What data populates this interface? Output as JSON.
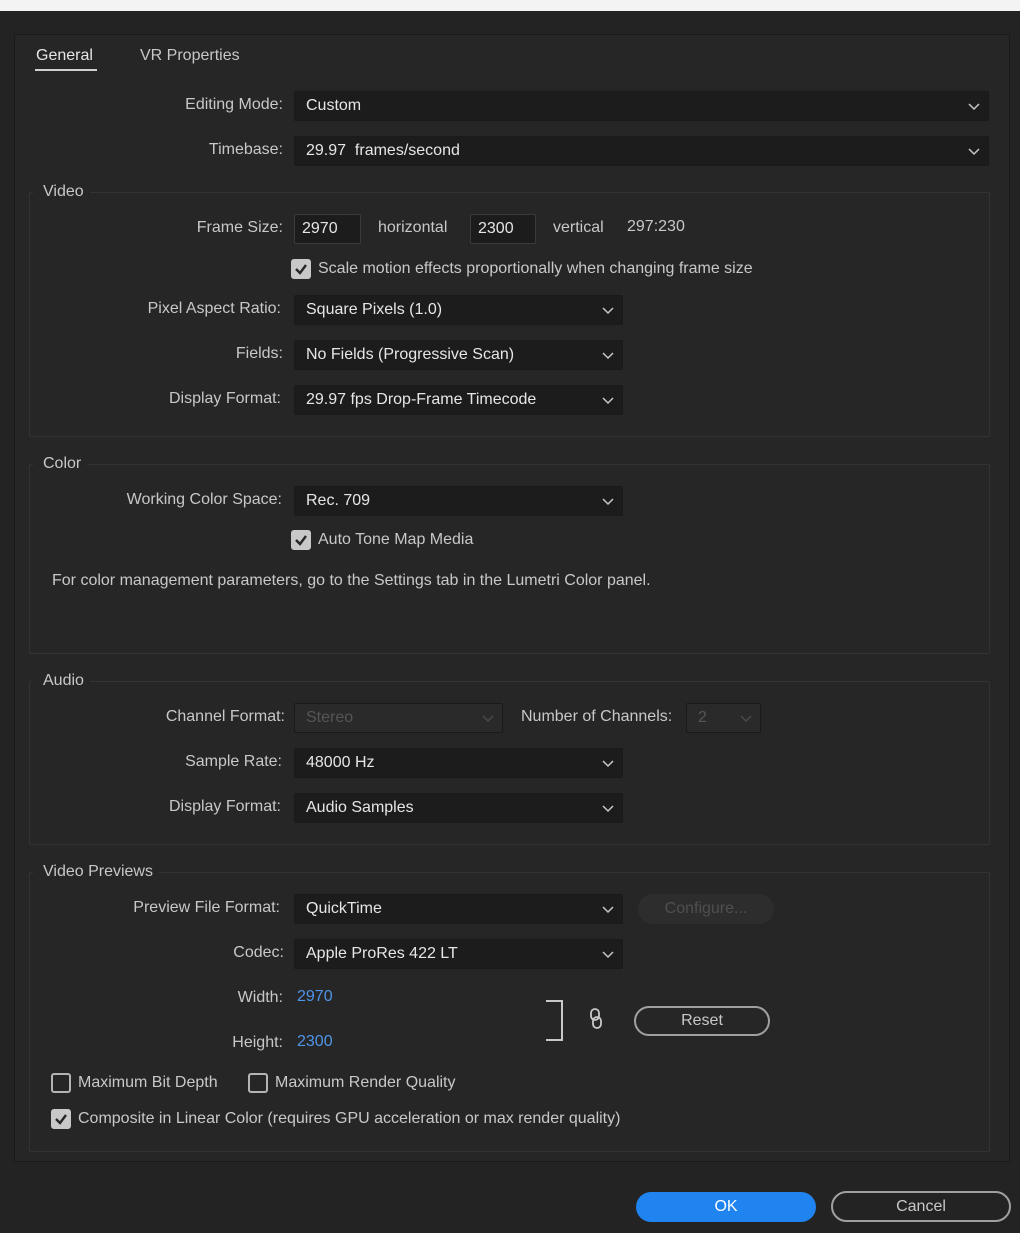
{
  "tabs": {
    "general": "General",
    "vr": "VR Properties"
  },
  "editing_mode": {
    "label": "Editing Mode:",
    "value": "Custom"
  },
  "timebase": {
    "label": "Timebase:",
    "value": "29.97  frames/second"
  },
  "video": {
    "title": "Video",
    "frame_size_label": "Frame Size:",
    "width": "2970",
    "horizontal_label": "horizontal",
    "height": "2300",
    "vertical_label": "vertical",
    "ratio": "297:230",
    "scale_motion_label": "Scale motion effects proportionally when changing frame size",
    "pixel_aspect_label": "Pixel Aspect Ratio:",
    "pixel_aspect_value": "Square Pixels (1.0)",
    "fields_label": "Fields:",
    "fields_value": "No Fields (Progressive Scan)",
    "display_format_label": "Display Format:",
    "display_format_value": "29.97 fps Drop-Frame Timecode"
  },
  "color": {
    "title": "Color",
    "working_space_label": "Working Color Space:",
    "working_space_value": "Rec. 709",
    "auto_tone_label": "Auto Tone Map Media",
    "note": "For color management parameters, go to the Settings tab in the Lumetri Color panel."
  },
  "audio": {
    "title": "Audio",
    "channel_format_label": "Channel Format:",
    "channel_format_value": "Stereo",
    "num_channels_label": "Number of Channels:",
    "num_channels_value": "2",
    "sample_rate_label": "Sample Rate:",
    "sample_rate_value": "48000 Hz",
    "display_format_label": "Display Format:",
    "display_format_value": "Audio Samples"
  },
  "previews": {
    "title": "Video Previews",
    "file_format_label": "Preview File Format:",
    "file_format_value": "QuickTime",
    "configure_label": "Configure...",
    "codec_label": "Codec:",
    "codec_value": "Apple ProRes 422 LT",
    "width_label": "Width:",
    "width_value": "2970",
    "height_label": "Height:",
    "height_value": "2300",
    "reset_label": "Reset",
    "max_bit_depth_label": "Maximum Bit Depth",
    "max_render_quality_label": "Maximum Render Quality",
    "linear_color_label": "Composite in Linear Color (requires GPU acceleration or max render quality)"
  },
  "footer": {
    "ok_label": "OK",
    "cancel_label": "Cancel"
  },
  "colors": {
    "accent": "#1f84f0",
    "link": "#4f95e8",
    "background": "#232323"
  }
}
